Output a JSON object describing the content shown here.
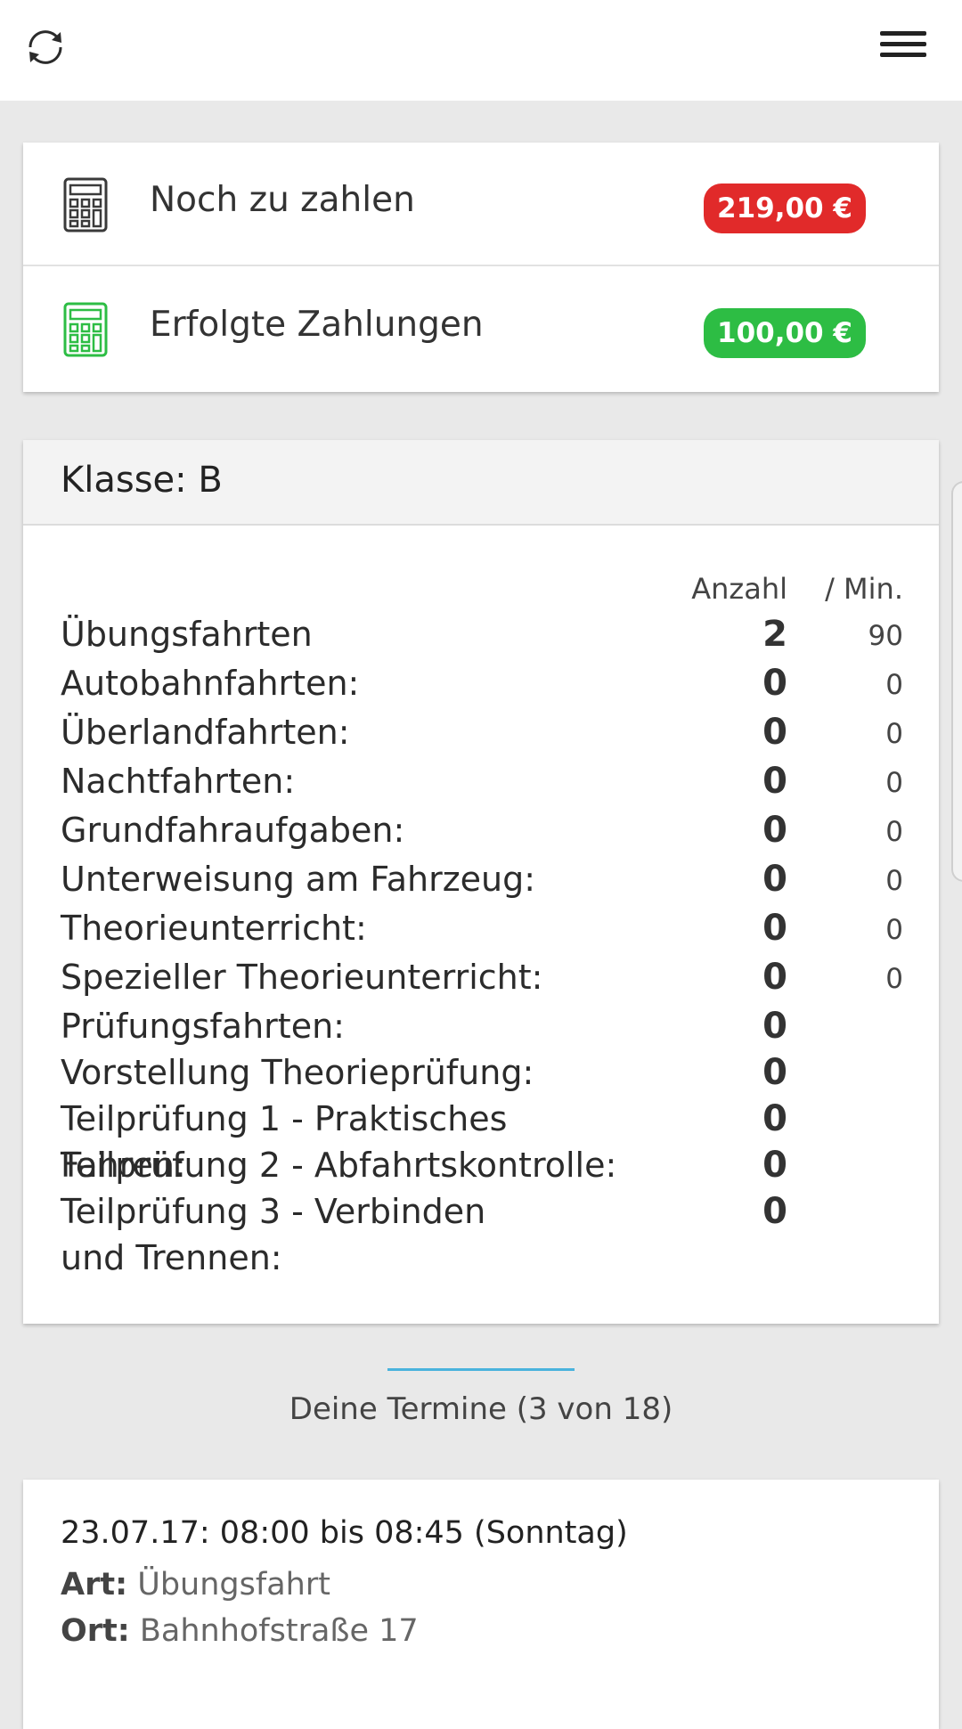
{
  "topbar": {
    "refresh_icon": "refresh-icon",
    "menu_icon": "hamburger-menu-icon"
  },
  "payments": {
    "due": {
      "label": "Noch zu zahlen",
      "amount": "219,00 €",
      "color": "#e12a2a",
      "icon": "calculator-icon"
    },
    "paid": {
      "label": "Erfolgte Zahlungen",
      "amount": "100,00 €",
      "color": "#2dbd44",
      "icon": "calculator-icon"
    }
  },
  "license_class": {
    "title": "Klasse: B",
    "col_count": "Anzahl",
    "col_minutes": "/ Min.",
    "rows": [
      {
        "label": "Übungsfahrten",
        "count": "2",
        "minutes": "90"
      },
      {
        "label": "Autobahnfahrten:",
        "count": "0",
        "minutes": "0"
      },
      {
        "label": "Überlandfahrten:",
        "count": "0",
        "minutes": "0"
      },
      {
        "label": "Nachtfahrten:",
        "count": "0",
        "minutes": "0"
      },
      {
        "label": "Grundfahraufgaben:",
        "count": "0",
        "minutes": "0"
      },
      {
        "label": "Unterweisung am Fahrzeug:",
        "count": "0",
        "minutes": "0"
      },
      {
        "label": "Theorieunterricht:",
        "count": "0",
        "minutes": "0"
      },
      {
        "label": "Spezieller Theorieunterricht:",
        "count": "0",
        "minutes": "0"
      },
      {
        "label": "Prüfungsfahrten:",
        "count": "0"
      },
      {
        "label": "Vorstellung Theorieprüfung:",
        "count": "0"
      },
      {
        "label": "Teilprüfung 1 - Praktisches Fahren:",
        "count": "0"
      },
      {
        "label": "Teilprüfung 2 - Abfahrtskontrolle:",
        "count": "0"
      },
      {
        "label": "Teilprüfung 3 - Verbinden und Trennen:",
        "count": "0"
      }
    ]
  },
  "appointments": {
    "title": "Deine Termine (3 von 18)",
    "accent": "#4ab3dd",
    "items": [
      {
        "time": "23.07.17: 08:00 bis 08:45 (Sonntag)",
        "type_label": "Art:",
        "type": "Übungsfahrt",
        "place_label": "Ort:",
        "place": "Bahnhofstraße 17"
      }
    ]
  }
}
